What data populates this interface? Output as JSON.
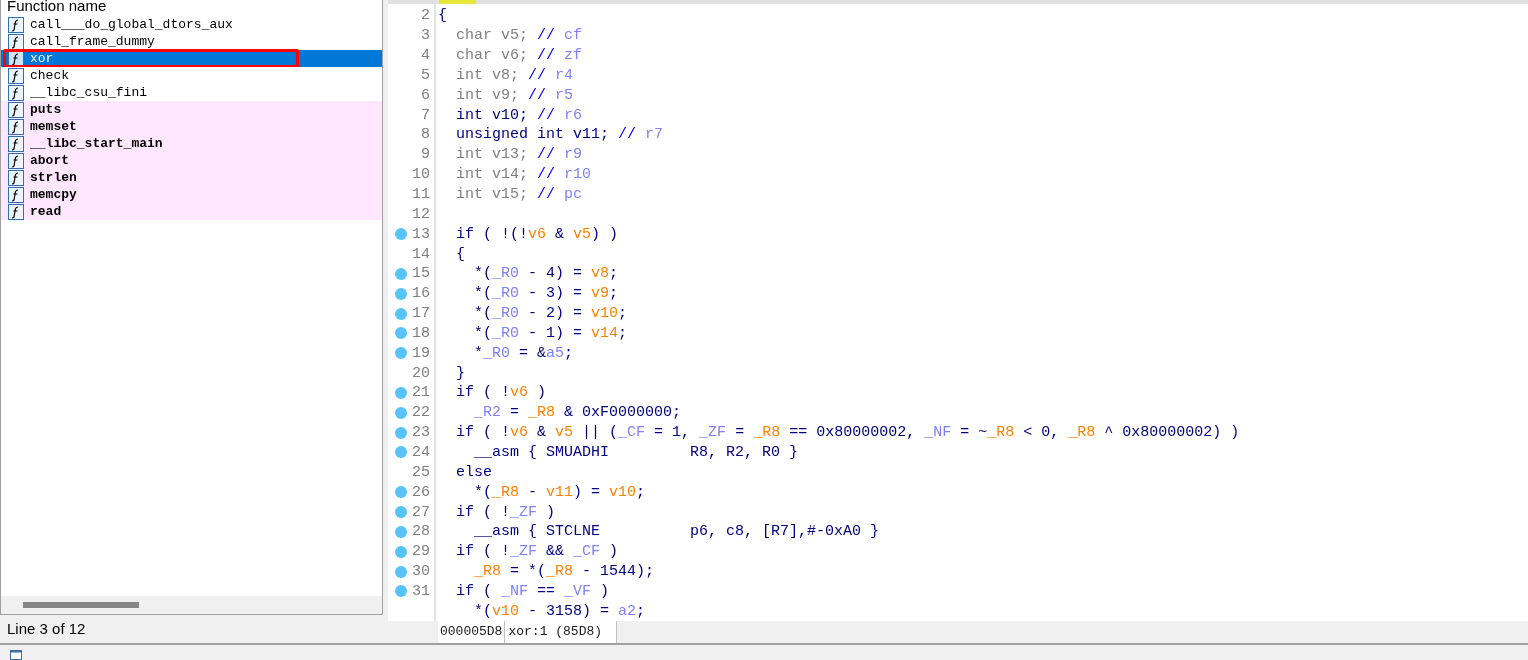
{
  "functions": {
    "header": "Function name",
    "items": [
      {
        "name": "call___do_global_dtors_aux",
        "kind": "local",
        "selected": false
      },
      {
        "name": "call_frame_dummy",
        "kind": "local",
        "selected": false
      },
      {
        "name": "xor",
        "kind": "local",
        "selected": true
      },
      {
        "name": "check",
        "kind": "local",
        "selected": false
      },
      {
        "name": "__libc_csu_fini",
        "kind": "local",
        "selected": false
      },
      {
        "name": "puts",
        "kind": "import",
        "selected": false
      },
      {
        "name": "memset",
        "kind": "import",
        "selected": false
      },
      {
        "name": "__libc_start_main",
        "kind": "import",
        "selected": false
      },
      {
        "name": "abort",
        "kind": "import",
        "selected": false
      },
      {
        "name": "strlen",
        "kind": "import",
        "selected": false
      },
      {
        "name": "memcpy",
        "kind": "import",
        "selected": false
      },
      {
        "name": "read",
        "kind": "import",
        "selected": false
      }
    ],
    "status": "Line 3 of 12"
  },
  "code": {
    "lines": [
      {
        "num": "2",
        "dot": false,
        "tokens": [
          {
            "text": "{",
            "kind": "plain"
          }
        ]
      },
      {
        "num": "3",
        "dot": false,
        "tokens": [
          {
            "text": "  char v5; ",
            "kind": "unused"
          },
          {
            "text": "// ",
            "kind": "comment"
          },
          {
            "text": "cf",
            "kind": "name"
          }
        ]
      },
      {
        "num": "4",
        "dot": false,
        "tokens": [
          {
            "text": "  char v6; ",
            "kind": "unused"
          },
          {
            "text": "// ",
            "kind": "comment"
          },
          {
            "text": "zf",
            "kind": "name"
          }
        ]
      },
      {
        "num": "5",
        "dot": false,
        "tokens": [
          {
            "text": "  int v8; ",
            "kind": "unused"
          },
          {
            "text": "// ",
            "kind": "comment"
          },
          {
            "text": "r4",
            "kind": "name"
          }
        ]
      },
      {
        "num": "6",
        "dot": false,
        "tokens": [
          {
            "text": "  int v9; ",
            "kind": "unused"
          },
          {
            "text": "// ",
            "kind": "comment"
          },
          {
            "text": "r5",
            "kind": "name"
          }
        ]
      },
      {
        "num": "7",
        "dot": false,
        "tokens": [
          {
            "text": "  int v10; ",
            "kind": "plain"
          },
          {
            "text": "// ",
            "kind": "comment"
          },
          {
            "text": "r6",
            "kind": "name"
          }
        ]
      },
      {
        "num": "8",
        "dot": false,
        "tokens": [
          {
            "text": "  unsigned int v11; ",
            "kind": "plain"
          },
          {
            "text": "// ",
            "kind": "comment"
          },
          {
            "text": "r7",
            "kind": "name"
          }
        ]
      },
      {
        "num": "9",
        "dot": false,
        "tokens": [
          {
            "text": "  int v13; ",
            "kind": "unused"
          },
          {
            "text": "// ",
            "kind": "comment"
          },
          {
            "text": "r9",
            "kind": "name"
          }
        ]
      },
      {
        "num": "10",
        "dot": false,
        "tokens": [
          {
            "text": "  int v14; ",
            "kind": "unused"
          },
          {
            "text": "// ",
            "kind": "comment"
          },
          {
            "text": "r10",
            "kind": "name"
          }
        ]
      },
      {
        "num": "11",
        "dot": false,
        "tokens": [
          {
            "text": "  int v15; ",
            "kind": "unused"
          },
          {
            "text": "// ",
            "kind": "comment"
          },
          {
            "text": "pc",
            "kind": "name"
          }
        ]
      },
      {
        "num": "12",
        "dot": false
      },
      {
        "num": "13",
        "dot": true,
        "tokens": [
          {
            "text": "  if ( !(!",
            "kind": "plain"
          },
          {
            "text": "v6",
            "kind": "var"
          },
          {
            "text": " & ",
            "kind": "plain"
          },
          {
            "text": "v5",
            "kind": "var"
          },
          {
            "text": ") )",
            "kind": "plain"
          }
        ]
      },
      {
        "num": "14",
        "dot": false,
        "tokens": [
          {
            "text": "  {",
            "kind": "plain"
          }
        ]
      },
      {
        "num": "15",
        "dot": true,
        "tokens": [
          {
            "text": "    *(",
            "kind": "plain"
          },
          {
            "text": "_R0",
            "kind": "name"
          },
          {
            "text": " - 4) = ",
            "kind": "plain"
          },
          {
            "text": "v8",
            "kind": "var"
          },
          {
            "text": ";",
            "kind": "plain"
          }
        ]
      },
      {
        "num": "16",
        "dot": true,
        "tokens": [
          {
            "text": "    *(",
            "kind": "plain"
          },
          {
            "text": "_R0",
            "kind": "name"
          },
          {
            "text": " - 3) = ",
            "kind": "plain"
          },
          {
            "text": "v9",
            "kind": "var"
          },
          {
            "text": ";",
            "kind": "plain"
          }
        ]
      },
      {
        "num": "17",
        "dot": true,
        "tokens": [
          {
            "text": "    *(",
            "kind": "plain"
          },
          {
            "text": "_R0",
            "kind": "name"
          },
          {
            "text": " - 2) = ",
            "kind": "plain"
          },
          {
            "text": "v10",
            "kind": "var"
          },
          {
            "text": ";",
            "kind": "plain"
          }
        ]
      },
      {
        "num": "18",
        "dot": true,
        "tokens": [
          {
            "text": "    *(",
            "kind": "plain"
          },
          {
            "text": "_R0",
            "kind": "name"
          },
          {
            "text": " - 1) = ",
            "kind": "plain"
          },
          {
            "text": "v14",
            "kind": "var"
          },
          {
            "text": ";",
            "kind": "plain"
          }
        ]
      },
      {
        "num": "19",
        "dot": true,
        "tokens": [
          {
            "text": "    *",
            "kind": "plain"
          },
          {
            "text": "_R0",
            "kind": "name"
          },
          {
            "text": " = &",
            "kind": "plain"
          },
          {
            "text": "a5",
            "kind": "name"
          },
          {
            "text": ";",
            "kind": "plain"
          }
        ]
      },
      {
        "num": "20",
        "dot": false,
        "tokens": [
          {
            "text": "  }",
            "kind": "plain"
          }
        ]
      },
      {
        "num": "21",
        "dot": true,
        "tokens": [
          {
            "text": "  if ( !",
            "kind": "plain"
          },
          {
            "text": "v6",
            "kind": "var"
          },
          {
            "text": " )",
            "kind": "plain"
          }
        ]
      },
      {
        "num": "22",
        "dot": true,
        "tokens": [
          {
            "text": "    _R2",
            "kind": "name"
          },
          {
            "text": " = ",
            "kind": "plain"
          },
          {
            "text": "_R8",
            "kind": "var"
          },
          {
            "text": " & 0xF0000000;",
            "kind": "plain"
          }
        ]
      },
      {
        "num": "23",
        "dot": true,
        "tokens": [
          {
            "text": "  if ( !",
            "kind": "plain"
          },
          {
            "text": "v6",
            "kind": "var"
          },
          {
            "text": " & ",
            "kind": "plain"
          },
          {
            "text": "v5",
            "kind": "var"
          },
          {
            "text": " || (",
            "kind": "plain"
          },
          {
            "text": "_CF",
            "kind": "name"
          },
          {
            "text": " = 1, ",
            "kind": "plain"
          },
          {
            "text": "_ZF",
            "kind": "name"
          },
          {
            "text": " = ",
            "kind": "plain"
          },
          {
            "text": "_R8",
            "kind": "var"
          },
          {
            "text": " == 0x80000002, ",
            "kind": "plain"
          },
          {
            "text": "_NF",
            "kind": "name"
          },
          {
            "text": " = ~",
            "kind": "plain"
          },
          {
            "text": "_R8",
            "kind": "var"
          },
          {
            "text": " < 0, ",
            "kind": "plain"
          },
          {
            "text": "_R8",
            "kind": "var"
          },
          {
            "text": " ^ 0x80000002) )",
            "kind": "plain"
          }
        ]
      },
      {
        "num": "24",
        "dot": true,
        "tokens": [
          {
            "text": "    __asm { SMUADHI         R8, R2, R0 }",
            "kind": "plain"
          }
        ]
      },
      {
        "num": "25",
        "dot": false,
        "tokens": [
          {
            "text": "  else",
            "kind": "plain"
          }
        ]
      },
      {
        "num": "26",
        "dot": true,
        "tokens": [
          {
            "text": "    *(",
            "kind": "plain"
          },
          {
            "text": "_R8",
            "kind": "var"
          },
          {
            "text": " - ",
            "kind": "plain"
          },
          {
            "text": "v11",
            "kind": "var"
          },
          {
            "text": ") = ",
            "kind": "plain"
          },
          {
            "text": "v10",
            "kind": "var"
          },
          {
            "text": ";",
            "kind": "plain"
          }
        ]
      },
      {
        "num": "27",
        "dot": true,
        "tokens": [
          {
            "text": "  if ( !",
            "kind": "plain"
          },
          {
            "text": "_ZF",
            "kind": "name"
          },
          {
            "text": " )",
            "kind": "plain"
          }
        ]
      },
      {
        "num": "28",
        "dot": true,
        "tokens": [
          {
            "text": "    __asm { STCLNE          p6, c8, [R7],#-0xA0 }",
            "kind": "plain"
          }
        ]
      },
      {
        "num": "29",
        "dot": true,
        "tokens": [
          {
            "text": "  if ( !",
            "kind": "plain"
          },
          {
            "text": "_ZF",
            "kind": "name"
          },
          {
            "text": " && ",
            "kind": "plain"
          },
          {
            "text": "_CF",
            "kind": "name"
          },
          {
            "text": " )",
            "kind": "plain"
          }
        ]
      },
      {
        "num": "30",
        "dot": true,
        "tokens": [
          {
            "text": "    _R8",
            "kind": "var"
          },
          {
            "text": " = *(",
            "kind": "plain"
          },
          {
            "text": "_R8",
            "kind": "var"
          },
          {
            "text": " - 1544);",
            "kind": "plain"
          }
        ]
      },
      {
        "num": "31",
        "dot": true,
        "tokens": [
          {
            "text": "  if ( ",
            "kind": "plain"
          },
          {
            "text": "_NF",
            "kind": "name"
          },
          {
            "text": " == ",
            "kind": "plain"
          },
          {
            "text": "_VF",
            "kind": "name"
          },
          {
            "text": " )",
            "kind": "plain"
          }
        ]
      },
      {
        "tokens": [
          {
            "text": "    *(",
            "kind": "plain"
          },
          {
            "text": "v10",
            "kind": "var"
          },
          {
            "text": " - 3158) = ",
            "kind": "plain"
          },
          {
            "text": "a2",
            "kind": "name"
          },
          {
            "text": ";",
            "kind": "plain"
          }
        ]
      }
    ],
    "address": "000005D8",
    "location": "xor:1 (85D8)"
  }
}
